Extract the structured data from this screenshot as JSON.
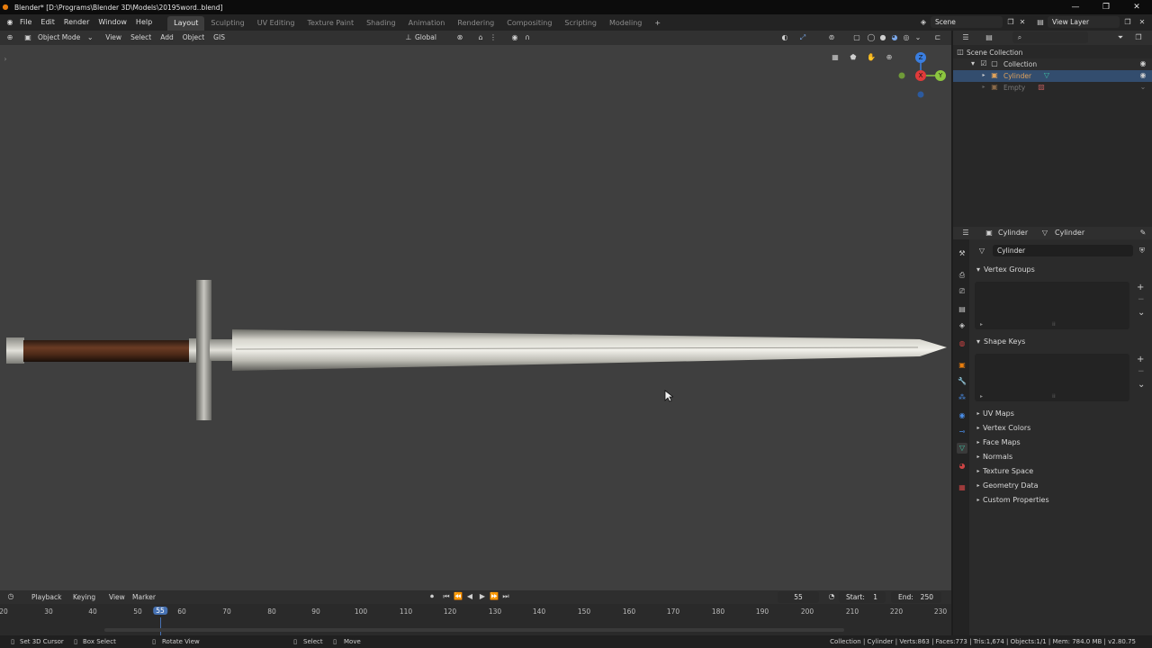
{
  "window": {
    "title": "Blender* [D:\\Programs\\Blender 3D\\Models\\20195word..blend]",
    "controls": [
      "—",
      "❐",
      "✕"
    ]
  },
  "menu": [
    "File",
    "Edit",
    "Render",
    "Window",
    "Help"
  ],
  "workspaces": [
    "Layout",
    "Sculpting",
    "UV Editing",
    "Texture Paint",
    "Shading",
    "Animation",
    "Rendering",
    "Compositing",
    "Scripting",
    "Modeling"
  ],
  "add_workspace": "+",
  "scene": {
    "name": "Scene",
    "view_layer": "View Layer"
  },
  "viewport_header": {
    "mode": "Object Mode",
    "menus": [
      "View",
      "Select",
      "Add",
      "Object",
      "GIS"
    ],
    "orientation": "Global"
  },
  "gizmo": {
    "z": "Z",
    "x": "X",
    "y": "Y"
  },
  "outliner": {
    "search_placeholder": "",
    "rows": [
      {
        "label": "Scene Collection",
        "indent": 0
      },
      {
        "label": "Collection",
        "indent": 1
      },
      {
        "label": "Cylinder",
        "indent": 2,
        "color": "#e0a25a"
      },
      {
        "label": "Empty",
        "indent": 2,
        "color": "#7a7a7a"
      }
    ]
  },
  "properties": {
    "object": "Cylinder",
    "data": "Cylinder",
    "mesh_name": "Cylinder",
    "open_panels": [
      "Vertex Groups",
      "Shape Keys"
    ],
    "closed_panels": [
      "UV Maps",
      "Vertex Colors",
      "Face Maps",
      "Normals",
      "Texture Space",
      "Geometry Data",
      "Custom Properties"
    ],
    "plus": "+",
    "minus": "−",
    "chevron": "⌄"
  },
  "timeline": {
    "menus": [
      "Playback",
      "Keying",
      "View",
      "Marker"
    ],
    "current_frame": "55",
    "start_label": "Start:",
    "start": "1",
    "end_label": "End:",
    "end": "250",
    "ticks": [
      "20",
      "30",
      "40",
      "50",
      "55",
      "60",
      "70",
      "80",
      "90",
      "100",
      "110",
      "120",
      "130",
      "140",
      "150",
      "160",
      "170",
      "180",
      "190",
      "200",
      "210",
      "220",
      "230"
    ]
  },
  "statusbar": {
    "left": [
      "Set 3D Cursor",
      "Box Select",
      "Rotate View",
      "Select",
      "Move"
    ],
    "right": "Collection | Cylinder | Verts:863 | Faces:773 | Tris:1,674 | Objects:1/1 | Mem: 784.0 MB | v2.80.75"
  },
  "colors": {
    "accent": "#4772b3",
    "viewport_bg": "#3f3f3f",
    "active_object": "#e0a25a",
    "gizmo_x": "#e03a3a",
    "gizmo_y": "#8cc63f",
    "gizmo_z": "#3a7ee0"
  }
}
